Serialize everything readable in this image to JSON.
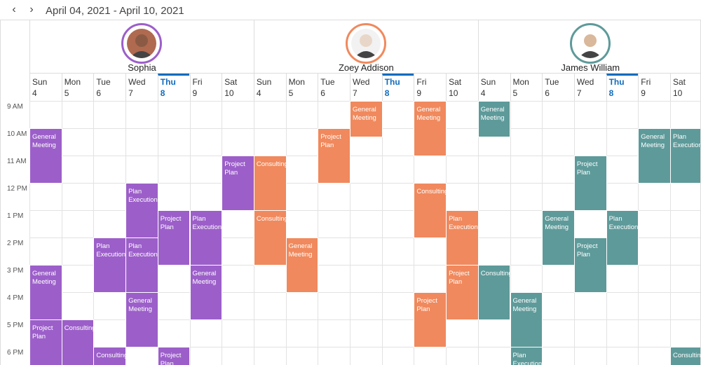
{
  "toolbar": {
    "prev_icon": "chevron-left-icon",
    "next_icon": "chevron-right-icon",
    "date_range": "April 04, 2021 - April 10, 2021"
  },
  "colors": {
    "sophia": "#9c5fc9",
    "zoey": "#f0895d",
    "james": "#5e9a9a",
    "today": "#0f6cbd"
  },
  "resources": [
    {
      "name": "Sophia",
      "ring": "#9c5fc9",
      "skin": "#8a5a44",
      "bg": "#b06a4f"
    },
    {
      "name": "Zoey Addison",
      "ring": "#f0895d",
      "skin": "#e8d7c8",
      "bg": "#f2f2f2"
    },
    {
      "name": "James William",
      "ring": "#5e9a9a",
      "skin": "#d9b89b",
      "bg": "#ffffff"
    }
  ],
  "days": [
    {
      "name": "Sun",
      "date": "4"
    },
    {
      "name": "Mon",
      "date": "5"
    },
    {
      "name": "Tue",
      "date": "6"
    },
    {
      "name": "Wed",
      "date": "7"
    },
    {
      "name": "Thu",
      "date": "8",
      "today": true
    },
    {
      "name": "Fri",
      "date": "9"
    },
    {
      "name": "Sat",
      "date": "10"
    }
  ],
  "times": [
    "9 AM",
    "10 AM",
    "11 AM",
    "12 PM",
    "1 PM",
    "2 PM",
    "3 PM",
    "4 PM",
    "5 PM",
    "6 PM"
  ],
  "appointments": [
    {
      "r": 0,
      "d": 0,
      "s": 1,
      "len": 2,
      "subject": "General Meeting"
    },
    {
      "r": 0,
      "d": 6,
      "s": 2,
      "len": 2,
      "subject": "Project Plan"
    },
    {
      "r": 0,
      "d": 3,
      "s": 3,
      "len": 2,
      "subject": "Plan Execution"
    },
    {
      "r": 0,
      "d": 4,
      "s": 4,
      "len": 2,
      "subject": "Project Plan"
    },
    {
      "r": 0,
      "d": 5,
      "s": 4,
      "len": 2,
      "subject": "Plan Execution"
    },
    {
      "r": 0,
      "d": 2,
      "s": 5,
      "len": 2,
      "subject": "Plan Execution"
    },
    {
      "r": 0,
      "d": 3,
      "s": 5,
      "len": 2,
      "subject": "Plan Execution"
    },
    {
      "r": 0,
      "d": 0,
      "s": 6,
      "len": 2,
      "subject": "General Meeting"
    },
    {
      "r": 0,
      "d": 5,
      "s": 6,
      "len": 2,
      "subject": "General Meeting"
    },
    {
      "r": 0,
      "d": 3,
      "s": 7,
      "len": 2,
      "subject": "General Meeting"
    },
    {
      "r": 0,
      "d": 0,
      "s": 8,
      "len": 2,
      "subject": "Project Plan"
    },
    {
      "r": 0,
      "d": 1,
      "s": 8,
      "len": 2,
      "subject": "Consulting"
    },
    {
      "r": 0,
      "d": 2,
      "s": 9,
      "len": 1,
      "subject": "Consulting"
    },
    {
      "r": 0,
      "d": 4,
      "s": 9,
      "len": 1,
      "subject": "Project Plan"
    },
    {
      "r": 1,
      "d": 3,
      "s": 0,
      "len": 1.3,
      "subject": "General Meeting"
    },
    {
      "r": 1,
      "d": 5,
      "s": 0,
      "len": 2,
      "subject": "General Meeting"
    },
    {
      "r": 1,
      "d": 2,
      "s": 1,
      "len": 2,
      "subject": "Project Plan"
    },
    {
      "r": 1,
      "d": 0,
      "s": 2,
      "len": 2,
      "subject": "Consulting"
    },
    {
      "r": 1,
      "d": 5,
      "s": 3,
      "len": 2,
      "subject": "Consulting"
    },
    {
      "r": 1,
      "d": 0,
      "s": 4,
      "len": 2,
      "subject": "Consulting"
    },
    {
      "r": 1,
      "d": 6,
      "s": 4,
      "len": 2,
      "subject": "Plan Execution"
    },
    {
      "r": 1,
      "d": 1,
      "s": 5,
      "len": 2,
      "subject": "General Meeting"
    },
    {
      "r": 1,
      "d": 6,
      "s": 6,
      "len": 2,
      "subject": "Project Plan"
    },
    {
      "r": 1,
      "d": 5,
      "s": 7,
      "len": 2,
      "subject": "Project Plan"
    },
    {
      "r": 2,
      "d": 0,
      "s": 0,
      "len": 1.3,
      "subject": "General Meeting"
    },
    {
      "r": 2,
      "d": 5,
      "s": 1,
      "len": 2,
      "subject": "General Meeting"
    },
    {
      "r": 2,
      "d": 6,
      "s": 1,
      "len": 2,
      "subject": "Plan Execution"
    },
    {
      "r": 2,
      "d": 3,
      "s": 2,
      "len": 2,
      "subject": "Project Plan"
    },
    {
      "r": 2,
      "d": 2,
      "s": 4,
      "len": 2,
      "subject": "General Meeting"
    },
    {
      "r": 2,
      "d": 4,
      "s": 4,
      "len": 2,
      "subject": "Plan Execution"
    },
    {
      "r": 2,
      "d": 3,
      "s": 5,
      "len": 2,
      "subject": "Project Plan"
    },
    {
      "r": 2,
      "d": 0,
      "s": 6,
      "len": 2,
      "subject": "Consulting"
    },
    {
      "r": 2,
      "d": 1,
      "s": 7,
      "len": 2,
      "subject": "General Meeting"
    },
    {
      "r": 2,
      "d": 1,
      "s": 9,
      "len": 1,
      "subject": "Plan Execution"
    },
    {
      "r": 2,
      "d": 6,
      "s": 9,
      "len": 1,
      "subject": "Consulting"
    }
  ]
}
